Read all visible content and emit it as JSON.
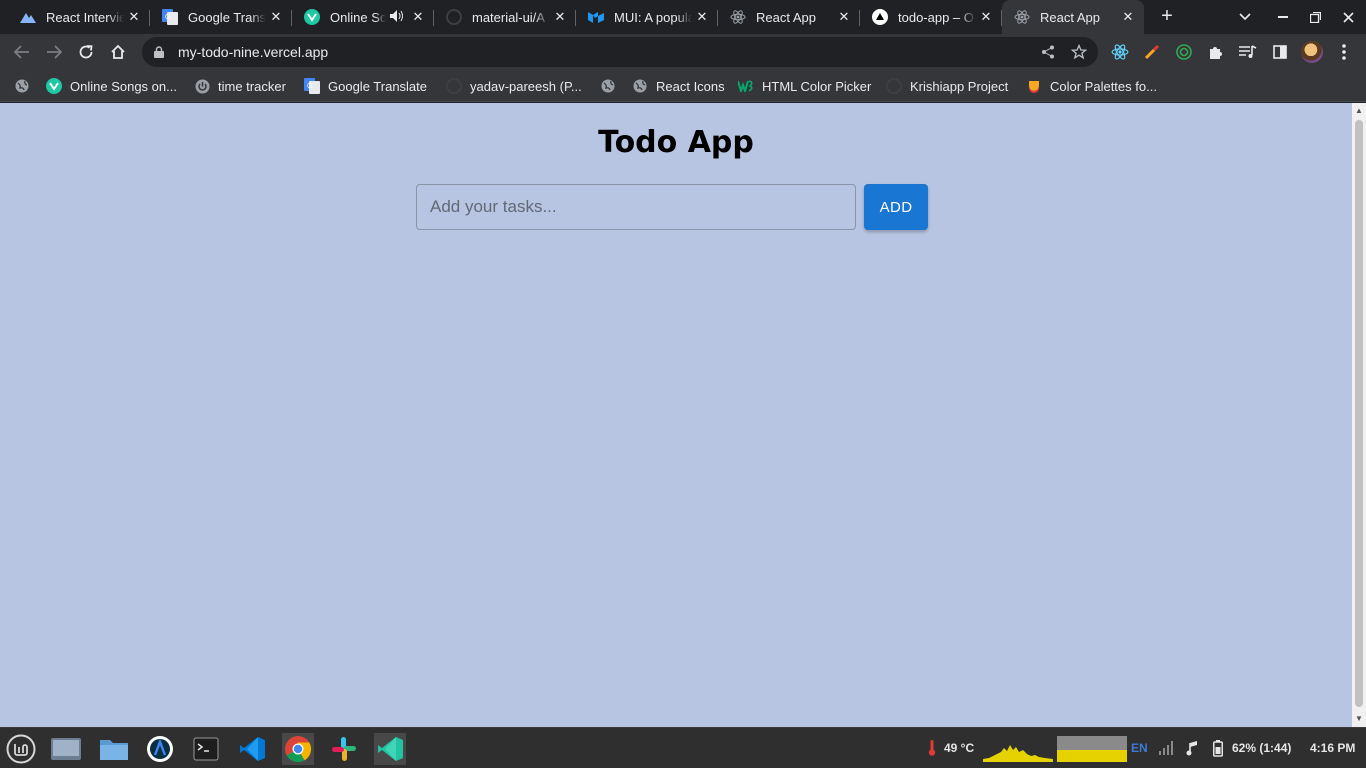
{
  "browser": {
    "tabs": [
      {
        "title": "React Interview",
        "icon": "triangle-mountain-icon"
      },
      {
        "title": "Google Translate",
        "icon": "google-translate-icon"
      },
      {
        "title": "Online Songs",
        "icon": "vue-icon",
        "audio": true
      },
      {
        "title": "material-ui/A",
        "icon": "github-icon"
      },
      {
        "title": "MUI: A popular",
        "icon": "mui-icon"
      },
      {
        "title": "React App",
        "icon": "react-icon"
      },
      {
        "title": "todo-app – O",
        "icon": "vercel-icon"
      },
      {
        "title": "React App",
        "icon": "react-icon",
        "active": true
      }
    ],
    "url": "my-todo-nine.vercel.app",
    "bookmarks": [
      {
        "label": "",
        "icon": "globe-icon"
      },
      {
        "label": "Online Songs on...",
        "icon": "vue-icon"
      },
      {
        "label": "time tracker",
        "icon": "power-icon"
      },
      {
        "label": "Google Translate",
        "icon": "google-translate-icon"
      },
      {
        "label": "yadav-pareesh (P...",
        "icon": "github-icon"
      },
      {
        "label": "",
        "icon": "globe-icon"
      },
      {
        "label": "React Icons",
        "icon": "globe-icon"
      },
      {
        "label": "HTML Color Picker",
        "icon": "w3schools-icon"
      },
      {
        "label": "Krishiapp Project",
        "icon": "github-icon"
      },
      {
        "label": "Color Palettes fo...",
        "icon": "palette-icon"
      }
    ]
  },
  "app": {
    "title": "Todo App",
    "input_placeholder": "Add your tasks...",
    "input_value": "",
    "add_label": "ADD"
  },
  "colors": {
    "page_background": "#b8c5e2",
    "add_button": "#1976d2"
  },
  "taskbar": {
    "temperature": "49 °C",
    "keyboard_layout": "EN",
    "battery": "62% (1:44)",
    "clock": "4:16 PM"
  }
}
